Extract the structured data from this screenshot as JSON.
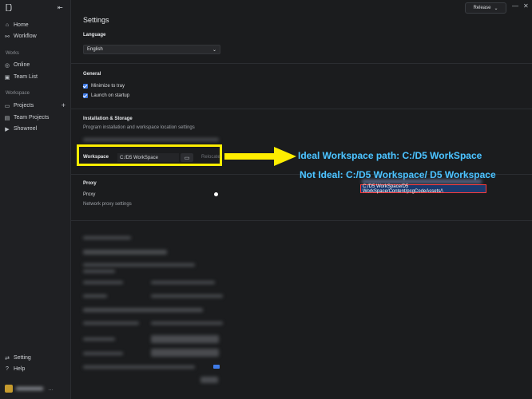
{
  "sidebar": {
    "items": [
      {
        "label": "Home",
        "icon": "home-icon"
      },
      {
        "label": "Workflow",
        "icon": "workflow-icon"
      },
      {
        "label": "Online",
        "icon": "online-icon"
      },
      {
        "label": "Team List",
        "icon": "team-list-icon"
      },
      {
        "label": "Projects",
        "icon": "projects-icon"
      },
      {
        "label": "Team Projects",
        "icon": "team-projects-icon"
      },
      {
        "label": "Showreel",
        "icon": "showreel-icon"
      },
      {
        "label": "Setting",
        "icon": "setting-icon"
      },
      {
        "label": "Help",
        "icon": "help-icon"
      }
    ],
    "section_works": "Works",
    "section_workspace": "Workspace"
  },
  "header": {
    "release_label": "Release",
    "title": "Settings"
  },
  "language": {
    "title": "Language",
    "value": "English"
  },
  "general": {
    "title": "General",
    "minimize_label": "Minimize to tray",
    "launch_label": "Launch on startup"
  },
  "installation": {
    "title": "Installation & Storage",
    "desc": "Program installation and workspace location settings",
    "workspace_label": "Workspace",
    "workspace_path": "C:/D5 WorkSpace",
    "relocate_label": "Relocate"
  },
  "proxy": {
    "title": "Proxy",
    "label": "Proxy",
    "desc": "Network proxy settings"
  },
  "annotations": {
    "ideal": "Ideal Workspace path: C:/D5 WorkSpace",
    "not_ideal": "Not Ideal: C:/D5 Workspace/ D5 Workspace",
    "path_box": "C:/D5 WorkSpace/D5 WorkSpace/Content/pcgCodeAssets/\\"
  },
  "colors": {
    "accent": "#3f7be8",
    "highlight": "#ffee00",
    "annotation": "#4fc3ff"
  }
}
